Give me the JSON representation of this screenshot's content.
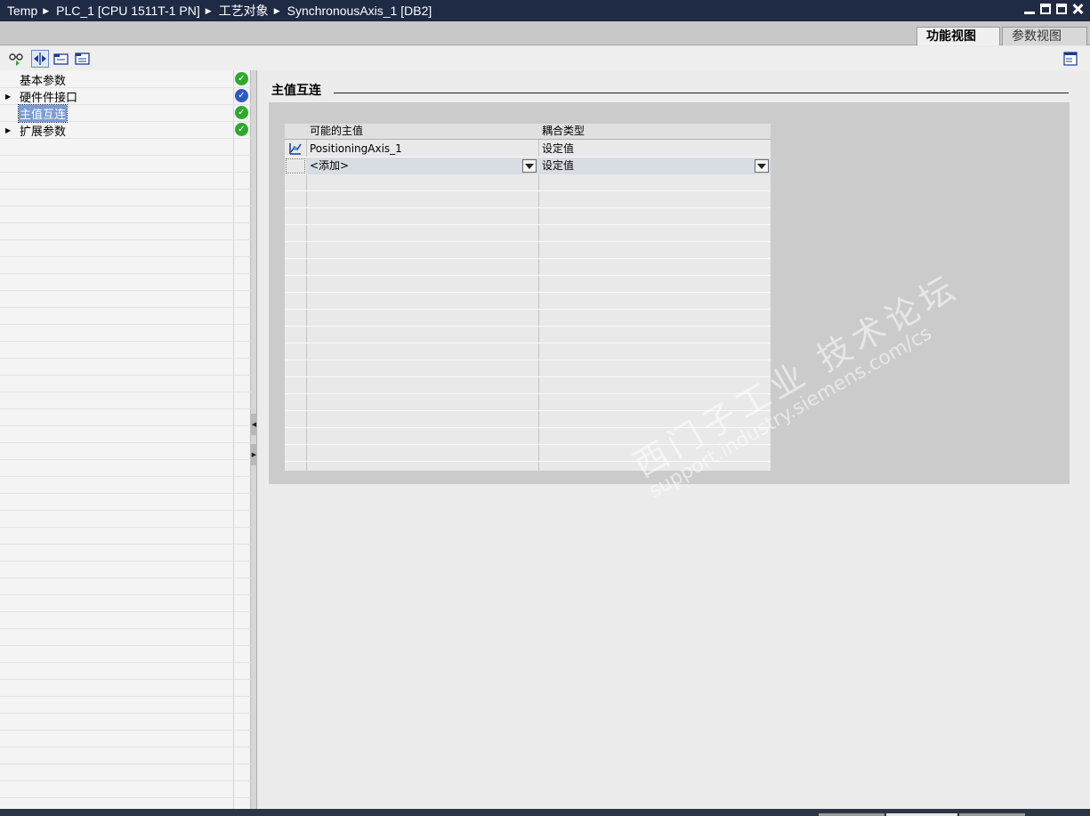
{
  "titlebar": {
    "breadcrumb": [
      "Temp",
      "PLC_1 [CPU 1511T-1 PN]",
      "工艺对象",
      "SynchronousAxis_1 [DB2]"
    ]
  },
  "view_tabs": {
    "function_view": "功能视图",
    "parameter_view": "参数视图",
    "active": "功能视图"
  },
  "toolbar": {
    "icons": [
      "show-glasses-icon",
      "expand-collapse-icon",
      "folder-view-icon",
      "folder-list-icon",
      "panel-settings-icon"
    ]
  },
  "nav": {
    "items": [
      {
        "label": "基本参数",
        "expandable": false,
        "status": "ok",
        "selected": false
      },
      {
        "label": "硬件件接口",
        "expandable": true,
        "status": "info",
        "selected": false
      },
      {
        "label": "主值互连",
        "expandable": false,
        "status": "ok",
        "selected": true
      },
      {
        "label": "扩展参数",
        "expandable": true,
        "status": "ok",
        "selected": false
      }
    ]
  },
  "main": {
    "section_title": "主值互连",
    "table": {
      "columns": [
        "可能的主值",
        "耦合类型"
      ],
      "rows": [
        {
          "master": "PositioningAxis_1",
          "coupling": "设定值",
          "icon": "axis-icon"
        },
        {
          "master": "<添加>",
          "coupling": "设定值",
          "dropdowns": true
        }
      ]
    }
  },
  "watermark": {
    "line1": "西门子工业 技术论坛",
    "line2": "support.industry.siemens.com/cs"
  },
  "colors": {
    "title_bar": "#1f2a44",
    "status_ok": "#2fa82f",
    "status_info": "#2f58c4",
    "selection": "#7b9bd1"
  }
}
